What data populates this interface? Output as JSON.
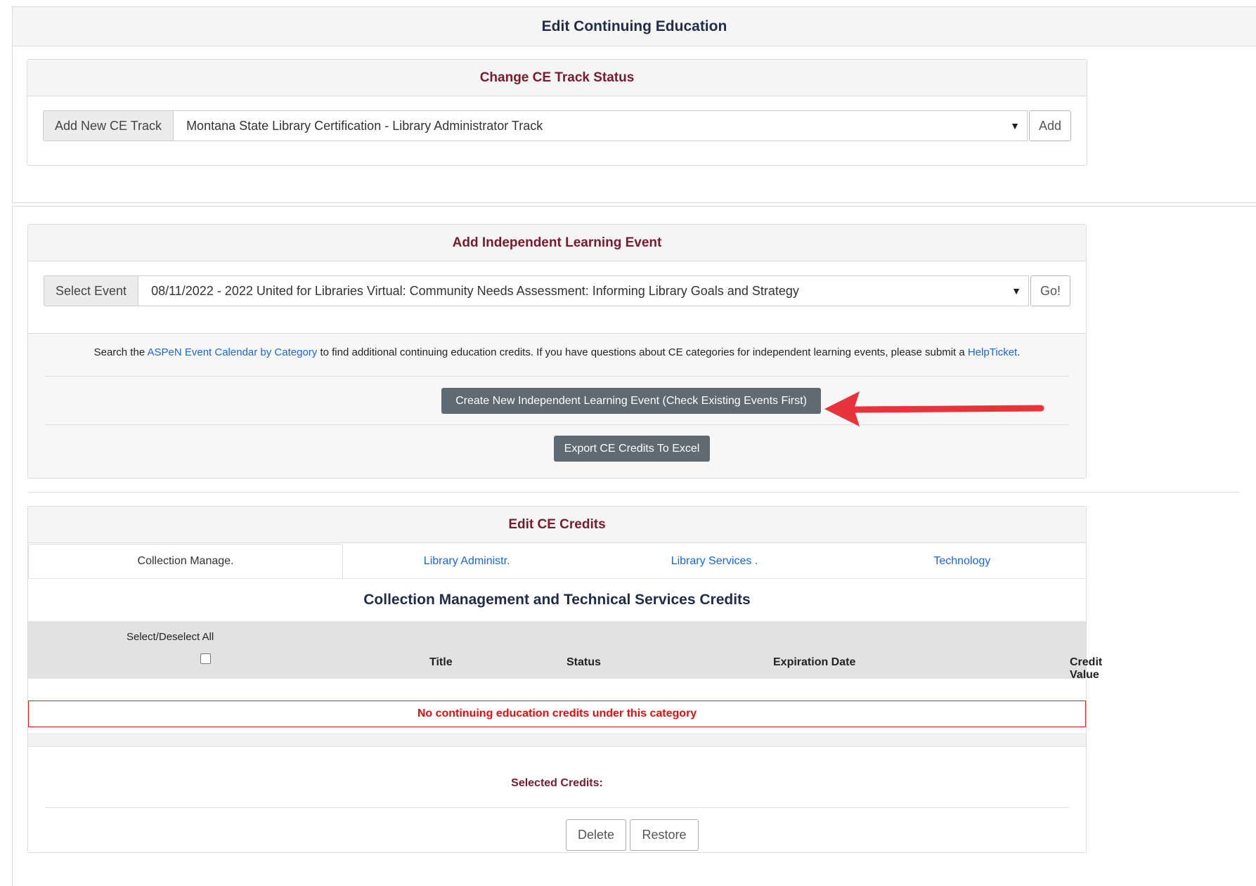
{
  "page_title": "Edit Continuing Education",
  "track_panel": {
    "title": "Change CE Track Status",
    "addon_label": "Add New CE Track",
    "selected_track": "Montana State Library Certification - Library Administrator Track",
    "add_button": "Add"
  },
  "event_panel": {
    "title": "Add Independent Learning Event",
    "addon_label": "Select Event",
    "selected_event": "08/11/2022 - 2022 United for Libraries Virtual: Community Needs Assessment: Informing Library Goals and Strategy",
    "go_button": "Go!",
    "note": {
      "prefix": "Search the ",
      "link1": "ASPeN Event Calendar by Category",
      "middle": " to find additional continuing education credits. If you have questions about CE categories for independent learning events, please submit a ",
      "link2": "HelpTicket",
      "suffix": "."
    },
    "create_button": "Create New Independent Learning Event (Check Existing Events First)",
    "export_button": "Export CE Credits To Excel"
  },
  "credits_panel": {
    "title": "Edit CE Credits",
    "tabs": [
      {
        "label": "Collection Manage.",
        "active": true
      },
      {
        "label": "Library Administr.",
        "active": false
      },
      {
        "label": "Library Services .",
        "active": false
      },
      {
        "label": "Technology",
        "active": false
      }
    ],
    "section_title": "Collection Management and Technical Services Credits",
    "select_all_label": "Select/Deselect All",
    "columns": {
      "title": "Title",
      "status": "Status",
      "expiration": "Expiration Date",
      "credit_value": "Credit Value"
    },
    "empty_message": "No continuing education credits under this category",
    "selected_credits_label": "Selected Credits:",
    "delete_button": "Delete",
    "restore_button": "Restore"
  },
  "colors": {
    "panel_title": "#7a1b2c",
    "link": "#1b66d6",
    "dark_button": "#5f6a72",
    "error": "#e01010",
    "arrow": "#e8333a"
  },
  "icons": {
    "select_chevron": "chevron-down-icon",
    "annotation_arrow": "red-arrow-icon"
  }
}
